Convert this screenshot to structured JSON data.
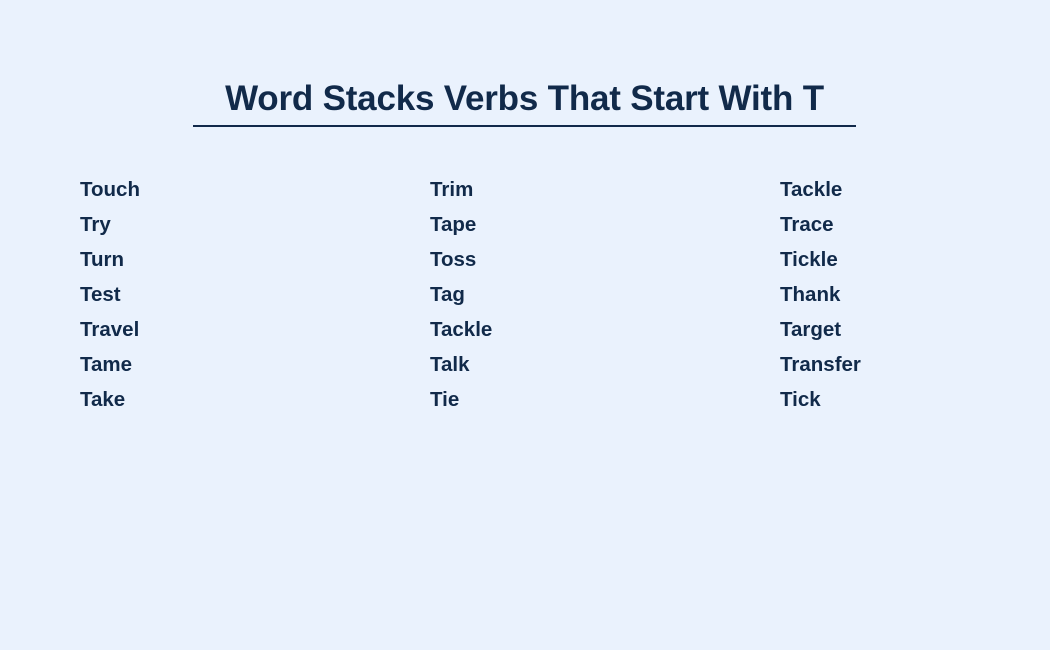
{
  "theme": {
    "background_color": "#eaf2fd",
    "text_color": "#112a4a",
    "rule_color": "#11294a"
  },
  "header": {
    "title": "Word Stacks Verbs That Start With T"
  },
  "word_list": {
    "columns": [
      {
        "id": "column-1",
        "words": [
          "Touch",
          "Try",
          "Turn",
          "Test",
          "Travel",
          "Tame",
          "Take"
        ]
      },
      {
        "id": "column-2",
        "words": [
          "Trim",
          "Tape",
          "Toss",
          "Tag",
          "Tackle",
          "Talk",
          "Tie"
        ]
      },
      {
        "id": "column-3",
        "words": [
          "Tackle",
          "Trace",
          "Tickle",
          "Thank",
          "Target",
          "Transfer",
          "Tick"
        ]
      }
    ]
  }
}
